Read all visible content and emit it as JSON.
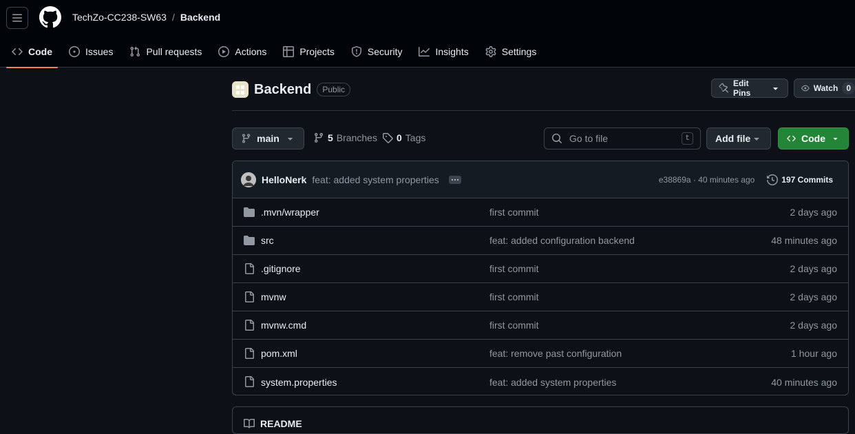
{
  "header": {
    "owner": "TechZo-CC238-SW63",
    "separator": "/",
    "repo": "Backend"
  },
  "nav": {
    "tabs": [
      {
        "label": "Code",
        "icon": "code-icon",
        "active": true
      },
      {
        "label": "Issues",
        "icon": "issue-opened-icon"
      },
      {
        "label": "Pull requests",
        "icon": "git-pull-request-icon"
      },
      {
        "label": "Actions",
        "icon": "play-icon"
      },
      {
        "label": "Projects",
        "icon": "table-icon"
      },
      {
        "label": "Security",
        "icon": "shield-icon"
      },
      {
        "label": "Insights",
        "icon": "graph-icon"
      },
      {
        "label": "Settings",
        "icon": "gear-icon"
      }
    ]
  },
  "repo": {
    "name": "Backend",
    "visibility": "Public",
    "edit_pins_label": "Edit Pins",
    "watch_label": "Watch",
    "watch_count": "0"
  },
  "toolbar": {
    "branch": "main",
    "branches_count": "5",
    "branches_label": "Branches",
    "tags_count": "0",
    "tags_label": "Tags",
    "goto_placeholder": "Go to file",
    "goto_shortcut": "t",
    "add_file_label": "Add file",
    "code_label": "Code"
  },
  "latest_commit": {
    "author": "HelloNerk",
    "message": "feat: added system properties",
    "meta": "e38869a · 40 minutes ago",
    "commits_label": "197 Commits"
  },
  "files": [
    {
      "type": "folder",
      "name": ".mvn/wrapper",
      "commit": "first commit",
      "date": "2 days ago"
    },
    {
      "type": "folder",
      "name": "src",
      "commit": "feat: added configuration backend",
      "date": "48 minutes ago"
    },
    {
      "type": "file",
      "name": ".gitignore",
      "commit": "first commit",
      "date": "2 days ago"
    },
    {
      "type": "file",
      "name": "mvnw",
      "commit": "first commit",
      "date": "2 days ago"
    },
    {
      "type": "file",
      "name": "mvnw.cmd",
      "commit": "first commit",
      "date": "2 days ago"
    },
    {
      "type": "file",
      "name": "pom.xml",
      "commit": "feat: remove past configuration",
      "date": "1 hour ago"
    },
    {
      "type": "file",
      "name": "system.properties",
      "commit": "feat: added system properties",
      "date": "40 minutes ago"
    }
  ],
  "readme": {
    "label": "README"
  },
  "colors": {
    "background": "#0d1117",
    "header_bg": "#010409",
    "accent_underline": "#f78166",
    "primary_button": "#238636",
    "border": "#3d444d",
    "muted_text": "#9198a1"
  }
}
